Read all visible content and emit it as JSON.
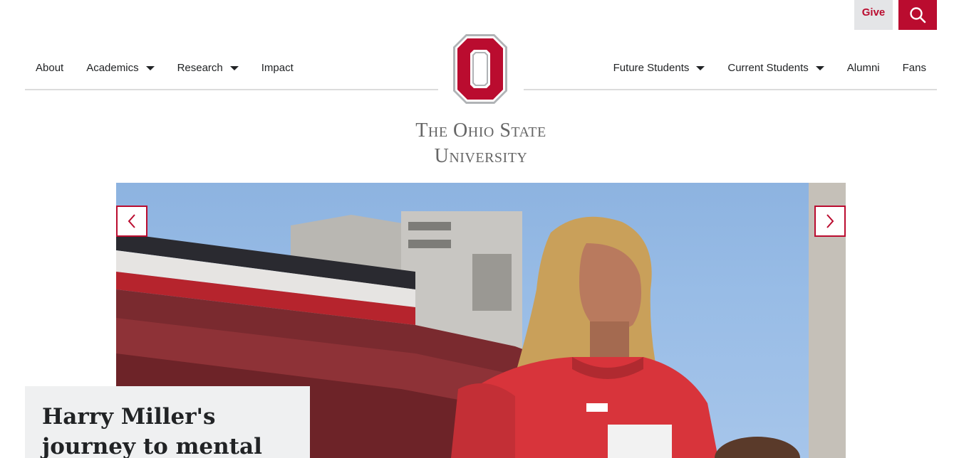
{
  "header": {
    "give_label": "Give",
    "search_icon": "search-icon",
    "university_name_line1": "The Ohio State",
    "university_name_line2": "University"
  },
  "nav_left": [
    {
      "label": "About",
      "dropdown": false
    },
    {
      "label": "Academics",
      "dropdown": true
    },
    {
      "label": "Research",
      "dropdown": true
    },
    {
      "label": "Impact",
      "dropdown": false
    }
  ],
  "nav_right": [
    {
      "label": "Future Students",
      "dropdown": true
    },
    {
      "label": "Current Students",
      "dropdown": true
    },
    {
      "label": "Alumni",
      "dropdown": false
    },
    {
      "label": "Fans",
      "dropdown": false
    }
  ],
  "hero": {
    "prev_icon": "chevron-left-icon",
    "next_icon": "chevron-right-icon",
    "caption": "Harry Miller's journey to mental"
  },
  "colors": {
    "scarlet": "#ba0c2f",
    "gray": "#666666",
    "light_gray": "#e4e5e7"
  }
}
